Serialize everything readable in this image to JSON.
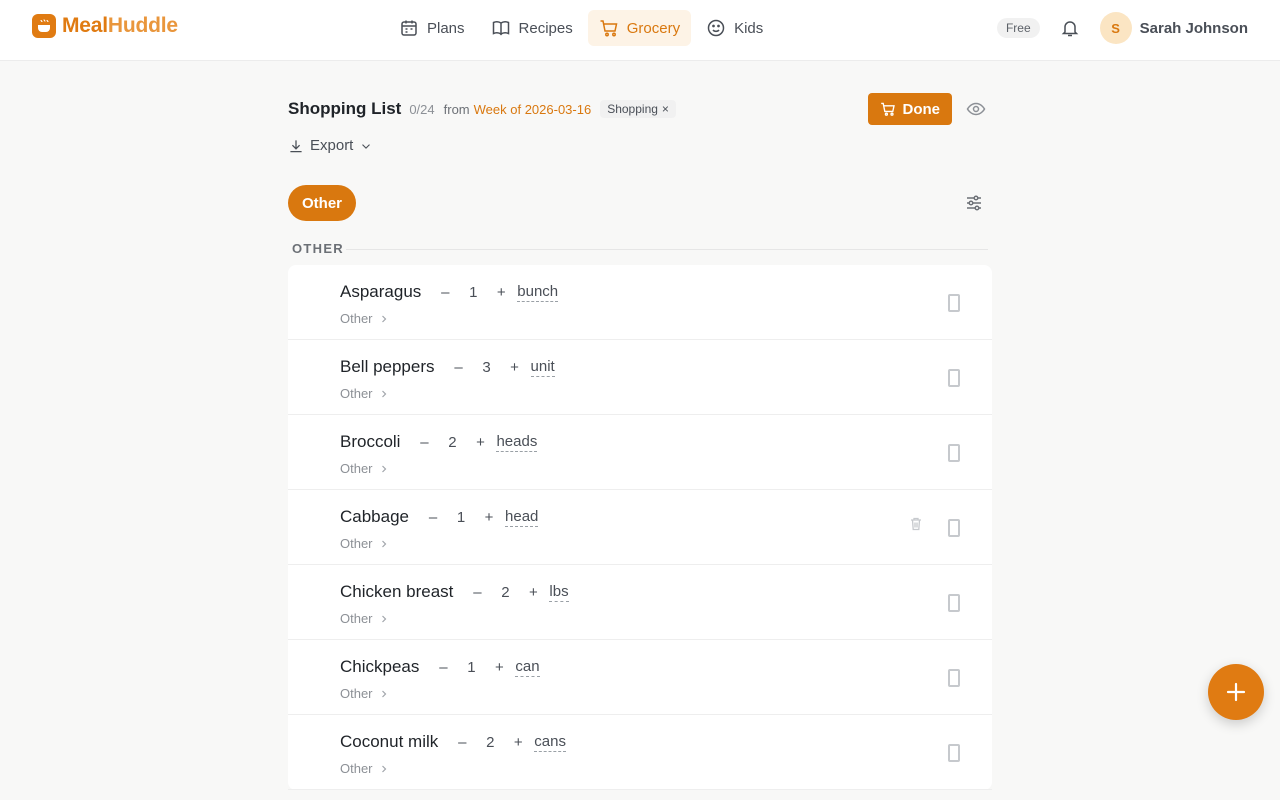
{
  "brand": {
    "part1": "Meal",
    "part2": "Huddle",
    "accent": "#e07b12"
  },
  "nav": {
    "items": [
      {
        "label": "Plans",
        "icon": "calendar-icon",
        "active": false
      },
      {
        "label": "Recipes",
        "icon": "book-icon",
        "active": false
      },
      {
        "label": "Grocery",
        "icon": "cart-icon",
        "active": true
      },
      {
        "label": "Kids",
        "icon": "smiley-icon",
        "active": false
      }
    ]
  },
  "account": {
    "plan": "Free",
    "avatar_initial": "S",
    "name": "Sarah Johnson"
  },
  "list": {
    "title": "Shopping List",
    "count": "0/24",
    "from_label": "from",
    "week_link": "Week of 2026-03-16",
    "status_tag": "Shopping",
    "status_tag_close": "×",
    "done_label": "Done",
    "export_label": "Export"
  },
  "filters": {
    "active_chip": "Other"
  },
  "section": {
    "label": "OTHER"
  },
  "items": [
    {
      "name": "Asparagus",
      "qty": "1",
      "unit": "bunch",
      "category": "Other"
    },
    {
      "name": "Bell peppers",
      "qty": "3",
      "unit": "unit",
      "category": "Other"
    },
    {
      "name": "Broccoli",
      "qty": "2",
      "unit": "heads",
      "category": "Other"
    },
    {
      "name": "Cabbage",
      "qty": "1",
      "unit": "head",
      "category": "Other"
    },
    {
      "name": "Chicken breast",
      "qty": "2",
      "unit": "lbs",
      "category": "Other"
    },
    {
      "name": "Chickpeas",
      "qty": "1",
      "unit": "can",
      "category": "Other"
    },
    {
      "name": "Coconut milk",
      "qty": "2",
      "unit": "cans",
      "category": "Other"
    }
  ],
  "qty_controls": {
    "minus": "–",
    "plus": "+"
  }
}
